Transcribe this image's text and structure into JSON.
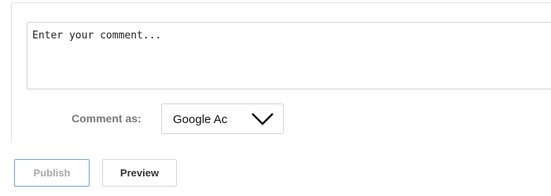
{
  "comment_form": {
    "textarea": {
      "placeholder": "Enter your comment...",
      "value": ""
    },
    "comment_as": {
      "label": "Comment as:",
      "selected_identity": "Google Ac",
      "dropdown_icon": "chevron-down-icon"
    },
    "actions": {
      "publish_label": "Publish",
      "publish_enabled": false,
      "preview_label": "Preview"
    }
  },
  "colors": {
    "publish_border": "#6aa0e6",
    "disabled_text": "#a8a8a8",
    "label_text": "#777777"
  }
}
